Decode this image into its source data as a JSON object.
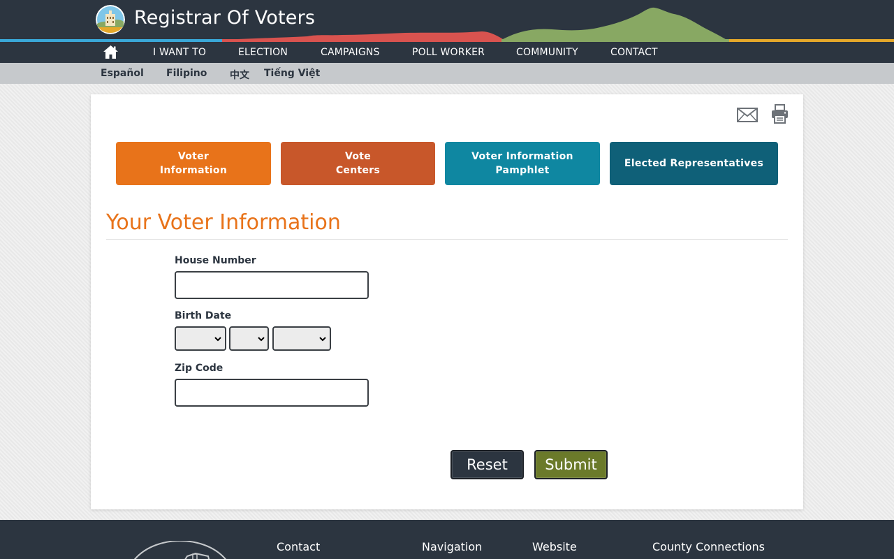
{
  "header": {
    "site_title": "Registrar Of Voters",
    "logo_icon": "county-seal-logo-icon",
    "colors": {
      "bar_background": "#2c3540",
      "blue": "#3aa8d8",
      "red": "#d9534f",
      "green": "#88a863",
      "gold": "#e5a82a"
    }
  },
  "main_nav": {
    "home_icon": "home-icon",
    "items": [
      {
        "label": "I WANT TO"
      },
      {
        "label": "ELECTION"
      },
      {
        "label": "CAMPAIGNS"
      },
      {
        "label": "POLL WORKER"
      },
      {
        "label": "COMMUNITY"
      },
      {
        "label": "CONTACT"
      }
    ]
  },
  "language_bar": {
    "items": [
      {
        "label": "Español"
      },
      {
        "label": "Filipino"
      },
      {
        "label": "中文"
      },
      {
        "label": "Tiếng Việt"
      }
    ]
  },
  "utility": {
    "email_icon": "envelope-icon",
    "print_icon": "printer-icon"
  },
  "tiles": [
    {
      "label": "Voter\nInformation",
      "color": "#e8731a"
    },
    {
      "label": "Vote\nCenters",
      "color": "#c8572a"
    },
    {
      "label": "Voter Information\nPamphlet",
      "color": "#0f87a1"
    },
    {
      "label": "Elected Representatives",
      "color": "#0f6078"
    }
  ],
  "form": {
    "title": "Your Voter Information",
    "house_number": {
      "label": "House Number",
      "value": ""
    },
    "birth_date": {
      "label": "Birth Date",
      "month": "",
      "day": "",
      "year": ""
    },
    "zip_code": {
      "label": "Zip Code",
      "value": ""
    },
    "reset_label": "Reset",
    "submit_label": "Submit",
    "colors": {
      "title": "#e8731a",
      "reset": "#2c3540",
      "submit": "#6b7a2a"
    }
  },
  "footer": {
    "headings": [
      {
        "label": "Contact"
      },
      {
        "label": "Navigation"
      },
      {
        "label": "Website"
      },
      {
        "label": "County Connections"
      }
    ]
  }
}
